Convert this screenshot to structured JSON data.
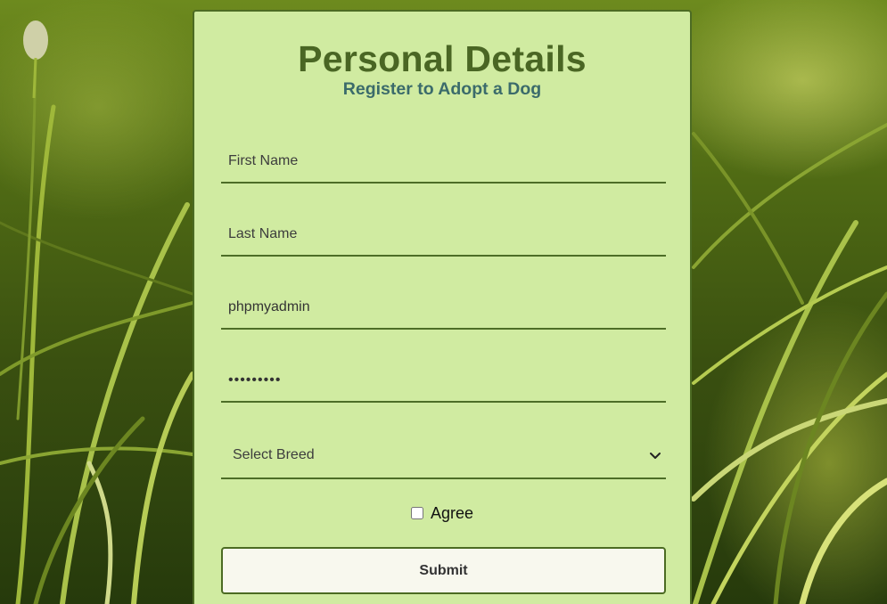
{
  "form": {
    "title": "Personal Details",
    "subtitle": "Register to Adopt a Dog",
    "first_name": {
      "placeholder": "First Name",
      "value": ""
    },
    "last_name": {
      "placeholder": "Last Name",
      "value": ""
    },
    "username": {
      "value": "phpmyadmin"
    },
    "password": {
      "value": "•••••••••"
    },
    "breed_select": {
      "selected": "Select Breed",
      "icon": "chevron-down-icon"
    },
    "agree_label": "Agree",
    "agree_checked": false,
    "submit_label": "Submit"
  },
  "colors": {
    "card_background": "#d0eba1",
    "accent_dark_green": "#4a6624",
    "subtitle_teal": "#3b6b6b"
  }
}
